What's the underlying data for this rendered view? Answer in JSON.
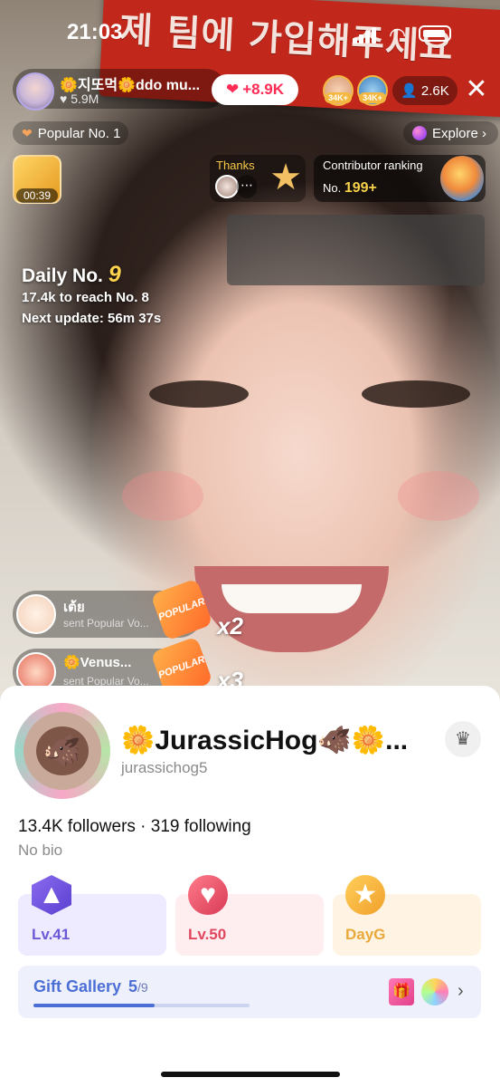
{
  "status_bar": {
    "time": "21:03"
  },
  "banner": {
    "text": "제 팀에 가입해주세요"
  },
  "host": {
    "name": "🌼지또먹🌼ddo mu...",
    "likes": "♥ 5.9M",
    "follow_label": "+8.9K"
  },
  "viewers": {
    "badge1": "34K+",
    "badge2": "34K+",
    "count": "2.6K"
  },
  "close_icon": "✕",
  "popular": {
    "label": "Popular No. 1"
  },
  "explore": {
    "label": "Explore ›"
  },
  "treasure": {
    "timer": "00:39"
  },
  "thanks": {
    "label": "Thanks"
  },
  "contributor": {
    "title": "Contributor ranking",
    "no_prefix": "No.",
    "value": "199+"
  },
  "daily": {
    "label": "Daily No.",
    "number": "9",
    "reach": "17.4k to reach No. 8",
    "update": "Next update: 56m 37s"
  },
  "gifts": [
    {
      "name": "เต้ย",
      "sub": "sent Popular Vo...",
      "icon": "POPULAR",
      "multiplier": "x2"
    },
    {
      "name": "🌼Venus...",
      "sub": "sent Popular Vo...",
      "icon": "POPULAR",
      "multiplier": "x3"
    }
  ],
  "profile": {
    "name": "🌼JurassicHog🐗🌼...",
    "handle": "jurassichog5",
    "followers_line": "13.4K followers · 319 following",
    "bio": "No bio",
    "badges": [
      {
        "label": "Lv.41",
        "icon": "level-icon"
      },
      {
        "label": "Lv.50",
        "icon": "fan-heart-icon"
      },
      {
        "label": "DayG",
        "icon": "team-star-icon"
      }
    ],
    "gift_gallery": {
      "title": "Gift Gallery",
      "count": "5",
      "total": "/9",
      "progress_fraction": 0.56
    }
  },
  "colors": {
    "accent_red": "#fe2c55",
    "banner_red": "#c2271b",
    "gallery_blue": "#4c6fd6",
    "level_purple": "#6b5ad6",
    "fan_pink": "#e0475f",
    "team_gold": "#e8a93a"
  }
}
